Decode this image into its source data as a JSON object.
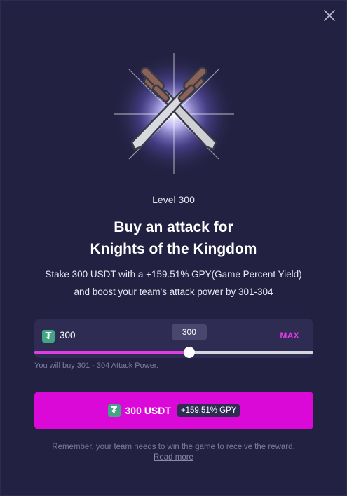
{
  "modal": {
    "close_icon": "close-icon",
    "hero_icon": "crossed-swords-icon",
    "level": "Level 300",
    "title_line1": "Buy an attack for",
    "title_line2": "Knights of the Kingdom",
    "desc_line1": "Stake 300 USDT with a +159.51% GPY(Game Percent Yield)",
    "desc_line2": "and boost your team's attack power by 301-304"
  },
  "stake": {
    "currency_icon": "tether-icon",
    "amount": "300",
    "max_label": "MAX",
    "slider_value": "300",
    "slider_fraction": 0.555,
    "note": "You will buy 301 - 304 Attack Power."
  },
  "cta": {
    "label": "300 USDT",
    "badge": "+159.51% GPY"
  },
  "footer": {
    "note": "Remember, your team needs to win the game to receive the reward.",
    "read_more": "Read more"
  },
  "colors": {
    "background": "#232141",
    "accent": "#db09d8",
    "tether": "#43a583"
  }
}
